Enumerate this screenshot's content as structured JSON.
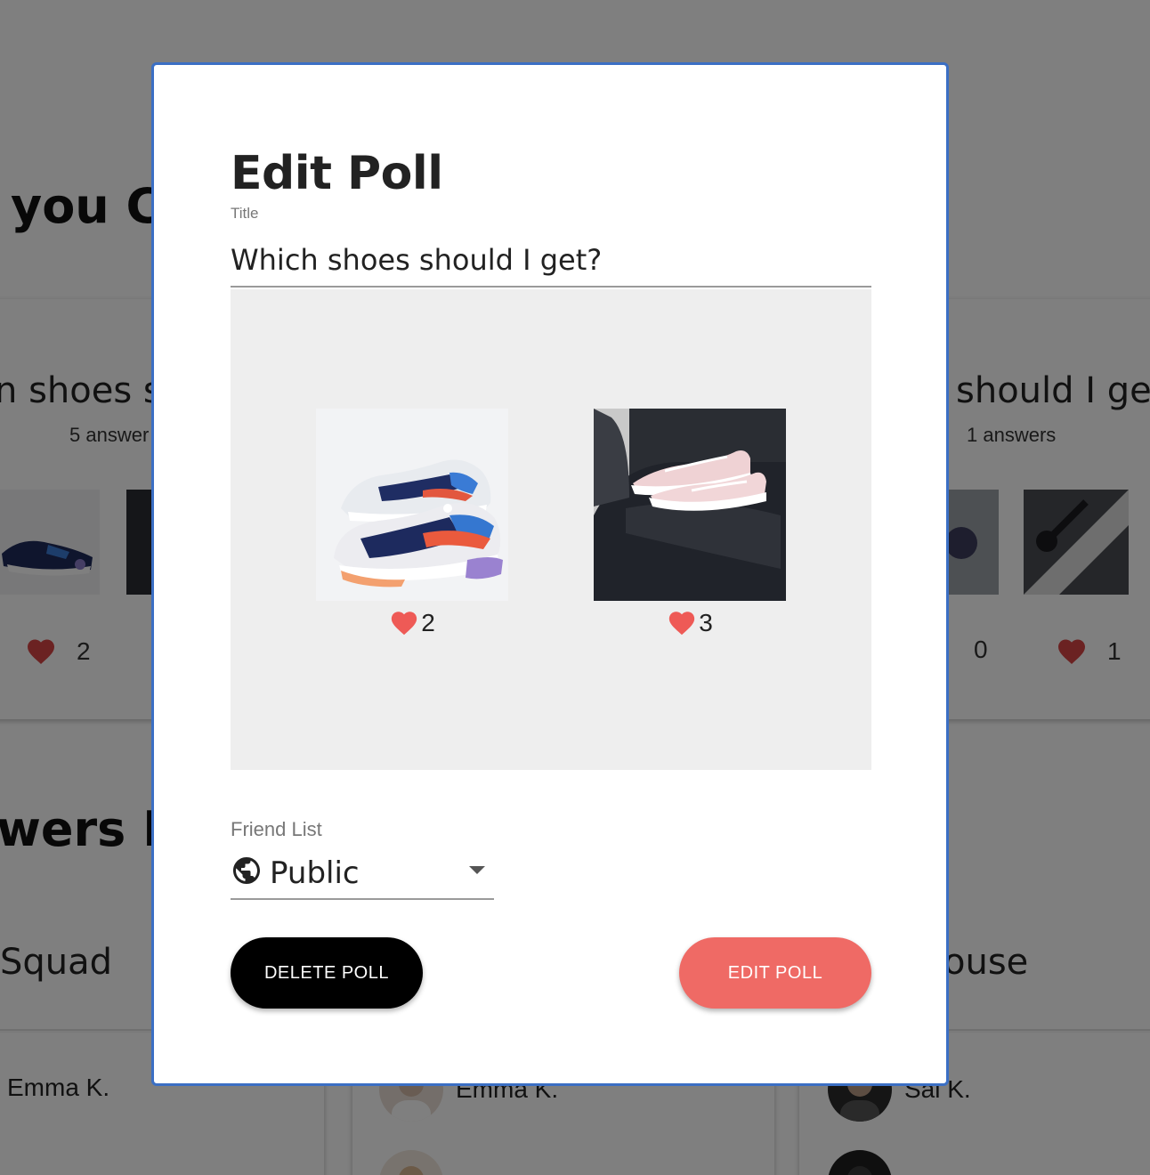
{
  "background": {
    "section_created_heading": "you Cr",
    "section_answers_heading": "wers L",
    "poll_cards": [
      {
        "title": "n shoes sh",
        "answers": "5 answer",
        "likes": [
          "2"
        ]
      },
      {
        "title": "should I get?",
        "answers": "1 answers",
        "likes": [
          "0",
          "1"
        ]
      }
    ],
    "groups": [
      {
        "title": "Squad",
        "members": [
          "Emma K."
        ]
      },
      {
        "title": "",
        "members": [
          "Emma K."
        ]
      },
      {
        "title": "ouse",
        "members": [
          "Sai K."
        ]
      }
    ]
  },
  "modal": {
    "heading": "Edit Poll",
    "title_label": "Title",
    "title_value": "Which shoes should I get?",
    "options": [
      {
        "image": "sneaker-white-blue-photo",
        "likes": "2"
      },
      {
        "image": "pink-shoes-on-sofa-photo",
        "likes": "3"
      }
    ],
    "friend_list_label": "Friend List",
    "friend_list_value": "Public",
    "delete_button": "DELETE POLL",
    "edit_button": "EDIT POLL"
  },
  "colors": {
    "accent": "#ef6a65",
    "modal_border": "#3b6fc4",
    "heart": "#ee5a56"
  }
}
